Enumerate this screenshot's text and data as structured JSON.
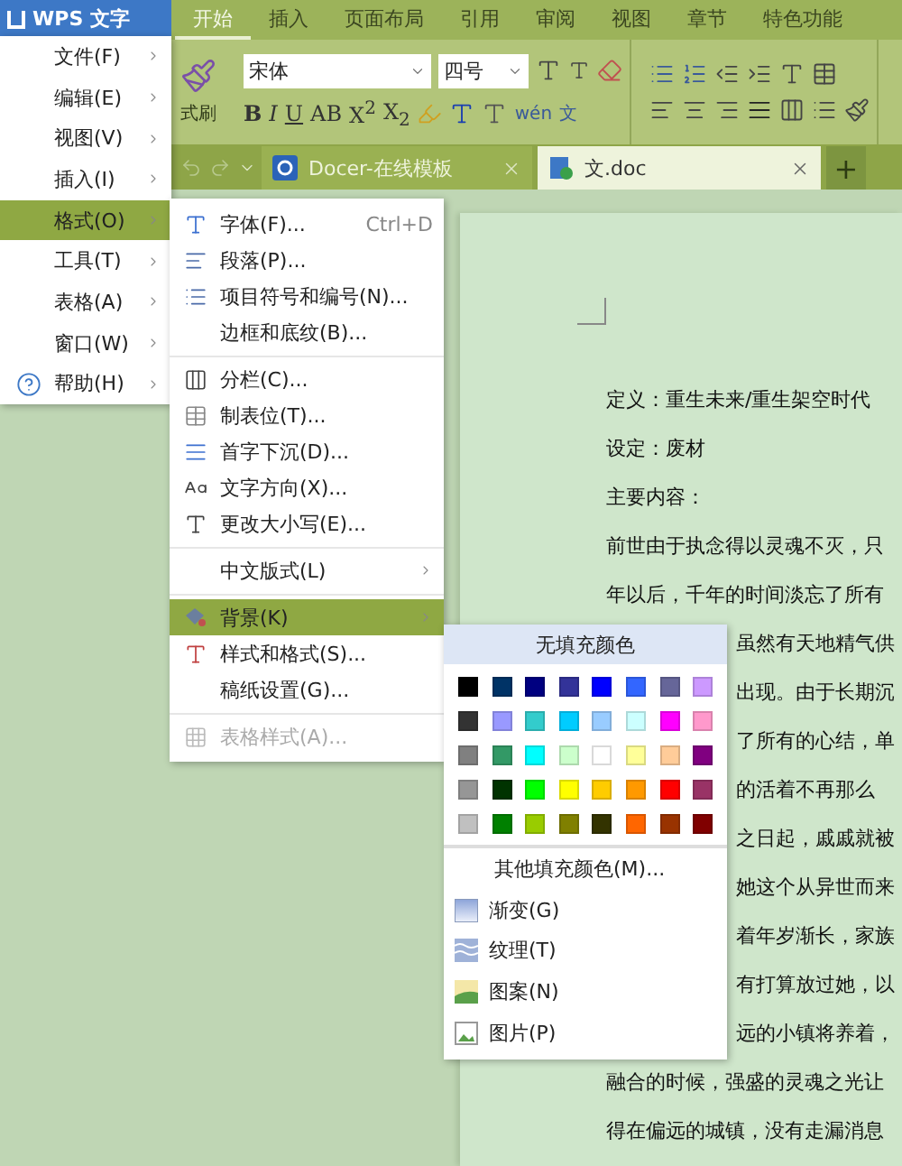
{
  "app_button": {
    "label": "WPS 文字"
  },
  "ribbon_tabs": [
    {
      "label": "开始",
      "selected": true
    },
    {
      "label": "插入",
      "selected": false
    },
    {
      "label": "页面布局",
      "selected": false
    },
    {
      "label": "引用",
      "selected": false
    },
    {
      "label": "审阅",
      "selected": false
    },
    {
      "label": "视图",
      "selected": false
    },
    {
      "label": "章节",
      "selected": false
    },
    {
      "label": "特色功能",
      "selected": false
    }
  ],
  "ribbon": {
    "format_painter": "式刷",
    "font": "宋体",
    "size": "四号",
    "text_buttons": [
      "B",
      "I",
      "U",
      "AB",
      "X$^{2}$",
      "X$_{2}$"
    ],
    "wen": "wén",
    "wen_char": "文"
  },
  "doc_tabs": [
    {
      "label": "Docer-在线模板",
      "selected": false
    },
    {
      "label": "文.doc",
      "selected": true
    }
  ],
  "new_tab": "+",
  "document": {
    "lines": [
      {
        "text": "定义：重生未来/重生架空时代",
        "kind": "full"
      },
      {
        "text": "设定：废材",
        "kind": "full"
      },
      {
        "text": "主要内容：",
        "kind": "full"
      },
      {
        "text": "前世由于执念得以灵魂不灭，只",
        "kind": "full"
      },
      {
        "text": "年以后，千年的时间淡忘了所有",
        "kind": "full"
      },
      {
        "text": "虽然有天地精气供",
        "kind": "covered"
      },
      {
        "text": "出现。由于长期沉",
        "kind": "covered"
      },
      {
        "text": "了所有的心结，单",
        "kind": "covered"
      },
      {
        "text": "的活着不再那么",
        "kind": "covered"
      },
      {
        "text": "之日起，戚戚就被",
        "kind": "covered"
      },
      {
        "text": "她这个从异世而来",
        "kind": "covered"
      },
      {
        "text": "着年岁渐长，家族",
        "kind": "covered"
      },
      {
        "text": "有打算放过她，以",
        "kind": "covered"
      },
      {
        "text": "远的小镇将养着，",
        "kind": "covered"
      },
      {
        "text": "融合的时候，强盛的灵魂之光让",
        "kind": "full"
      },
      {
        "text": "得在偏远的城镇，没有走漏消息",
        "kind": "full"
      }
    ]
  },
  "app_menu": {
    "items": [
      {
        "label": "文件(F)",
        "selected": false
      },
      {
        "label": "编辑(E)",
        "selected": false
      },
      {
        "label": "视图(V)",
        "selected": false
      },
      {
        "label": "插入(I)",
        "selected": false
      },
      {
        "label": "格式(O)",
        "selected": true
      },
      {
        "label": "工具(T)",
        "selected": false
      },
      {
        "label": "表格(A)",
        "selected": false
      },
      {
        "label": "窗口(W)",
        "selected": false
      },
      {
        "label": "帮助(H)",
        "selected": false
      }
    ]
  },
  "format_menu": {
    "groups": [
      [
        {
          "label": "字体(F)...",
          "shortcut": "Ctrl+D",
          "selected": false,
          "disabled": false,
          "submenu": false
        },
        {
          "label": "段落(P)...",
          "selected": false,
          "disabled": false,
          "submenu": false
        },
        {
          "label": "项目符号和编号(N)...",
          "selected": false,
          "disabled": false,
          "submenu": false
        },
        {
          "label": "边框和底纹(B)...",
          "selected": false,
          "disabled": false,
          "submenu": false
        }
      ],
      [
        {
          "label": "分栏(C)...",
          "selected": false,
          "disabled": false,
          "submenu": false
        },
        {
          "label": "制表位(T)...",
          "selected": false,
          "disabled": false,
          "submenu": false
        },
        {
          "label": "首字下沉(D)...",
          "selected": false,
          "disabled": false,
          "submenu": false
        },
        {
          "label": "文字方向(X)...",
          "selected": false,
          "disabled": false,
          "submenu": false
        },
        {
          "label": "更改大小写(E)...",
          "selected": false,
          "disabled": false,
          "submenu": false
        }
      ],
      [
        {
          "label": "中文版式(L)",
          "selected": false,
          "disabled": false,
          "submenu": true
        }
      ],
      [
        {
          "label": "背景(K)",
          "selected": true,
          "disabled": false,
          "submenu": true
        },
        {
          "label": "样式和格式(S)...",
          "selected": false,
          "disabled": false,
          "submenu": false
        },
        {
          "label": "稿纸设置(G)...",
          "selected": false,
          "disabled": false,
          "submenu": false
        }
      ],
      [
        {
          "label": "表格样式(A)...",
          "selected": false,
          "disabled": true,
          "submenu": false
        }
      ]
    ]
  },
  "background_menu": {
    "header": "无填充颜色",
    "swatches": [
      {
        "color": "#000000"
      },
      {
        "color": "#003366"
      },
      {
        "color": "#000080"
      },
      {
        "color": "#333399"
      },
      {
        "color": "#0000ff"
      },
      {
        "color": "#3366ff"
      },
      {
        "color": "#666699"
      },
      {
        "color": "#cc99ff"
      },
      {
        "color": "#333333"
      },
      {
        "color": "#9999ff"
      },
      {
        "color": "#33cccc"
      },
      {
        "color": "#00ccff"
      },
      {
        "color": "#99ccff"
      },
      {
        "color": "#ccffff"
      },
      {
        "color": "#ff00ff"
      },
      {
        "color": "#ff99cc"
      },
      {
        "color": "#808080"
      },
      {
        "color": "#339966"
      },
      {
        "color": "#00ffff"
      },
      {
        "color": "#ccffcc"
      },
      {
        "color": "#ffffff"
      },
      {
        "color": "#ffff99"
      },
      {
        "color": "#ffcc99"
      },
      {
        "color": "#800080"
      },
      {
        "color": "#969696"
      },
      {
        "color": "#003300"
      },
      {
        "color": "#00ff00"
      },
      {
        "color": "#ffff00"
      },
      {
        "color": "#ffcc00"
      },
      {
        "color": "#ff9900"
      },
      {
        "color": "#ff0000"
      },
      {
        "color": "#993366"
      },
      {
        "color": "#c0c0c0"
      },
      {
        "color": "#008000"
      },
      {
        "color": "#99cc00"
      },
      {
        "color": "#808000"
      },
      {
        "color": "#333300"
      },
      {
        "color": "#ff6600"
      },
      {
        "color": "#993300"
      },
      {
        "color": "#800000"
      }
    ],
    "items": [
      {
        "label": "其他填充颜色(M)...",
        "kind": "plain"
      },
      {
        "label": "渐变(G)",
        "kind": "gradient"
      },
      {
        "label": "纹理(T)",
        "kind": "texture"
      },
      {
        "label": "图案(N)",
        "kind": "pattern"
      },
      {
        "label": "图片(P)",
        "kind": "picture"
      }
    ]
  }
}
